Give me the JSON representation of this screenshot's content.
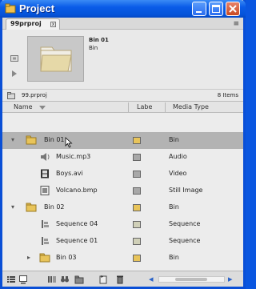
{
  "window": {
    "title": "Project",
    "colors": {
      "titlebar": "#0a5ce8",
      "accent_folder": "#e8c45a",
      "selected_row": "#b3b3b3"
    }
  },
  "tab": {
    "label": "99prproj",
    "close_glyph": "x",
    "menu_glyph": "≡"
  },
  "preview": {
    "clip_name": "Bin 01",
    "clip_type": "Bin",
    "side_icons": [
      "poster-frame-icon",
      "play-icon"
    ]
  },
  "infobar": {
    "project_name": "99.prproj",
    "item_count": "8 Items"
  },
  "columns": {
    "name": "Name",
    "label": "Labe",
    "media_type": "Media Type"
  },
  "rows": [
    {
      "twisty": "▾",
      "icon": "bin-folder-icon",
      "name": "Bin 01",
      "label_color": "#e8c45a",
      "media_type": "Bin",
      "selected": true
    },
    {
      "twisty": "",
      "icon": "audio-icon",
      "name": "Music.mp3",
      "label_color": "#a8a8a8",
      "media_type": "Audio",
      "selected": false
    },
    {
      "twisty": "",
      "icon": "film-icon",
      "name": "Boys.avi",
      "label_color": "#a8a8a8",
      "media_type": "Video",
      "selected": false
    },
    {
      "twisty": "",
      "icon": "still-image-icon",
      "name": "Volcano.bmp",
      "label_color": "#a8a8a8",
      "media_type": "Still Image",
      "selected": false
    },
    {
      "twisty": "▾",
      "icon": "bin-folder-icon",
      "name": "Bin 02",
      "label_color": "#e8c45a",
      "media_type": "Bin",
      "selected": false
    },
    {
      "twisty": "",
      "icon": "sequence-icon",
      "name": "Sequence 04",
      "label_color": "#d0d0b8",
      "media_type": "Sequence",
      "selected": false
    },
    {
      "twisty": "",
      "icon": "sequence-icon",
      "name": "Sequence 01",
      "label_color": "#d0d0b8",
      "media_type": "Sequence",
      "selected": false
    },
    {
      "twisty": "▸",
      "icon": "bin-folder-icon",
      "name": "Bin 03",
      "label_color": "#e8c45a",
      "media_type": "Bin",
      "selected": false
    }
  ],
  "bottombar": {
    "icons": [
      "list-view-icon",
      "icon-view-icon",
      "automate-to-sequence-icon",
      "find-icon",
      "new-bin-icon",
      "new-item-icon",
      "delete-icon"
    ]
  }
}
